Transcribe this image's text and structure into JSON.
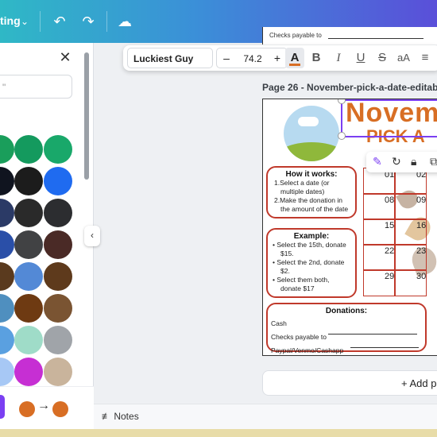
{
  "topbar": {
    "menu_label": "ting",
    "icons": [
      "chevron-down-icon",
      "undo-icon",
      "redo-icon",
      "cloud-saved-icon"
    ]
  },
  "panel": {
    "search_placeholder": "\"",
    "swatches": [
      "#1a9e5b",
      "#149a5e",
      "#19a86a",
      "#10141f",
      "#1c1c1c",
      "#1f6bf0",
      "#2b3a66",
      "#2a2a2a",
      "#2c2d30",
      "#2a4fa8",
      "#414244",
      "#4a2a26",
      "#5a3a1e",
      "#5389d6",
      "#5e3a1c",
      "#4f8fbf",
      "#6e3a12",
      "#7a5432",
      "#5aa0e0",
      "#9fdcc8",
      "#a0a4a9",
      "#a7c8f5",
      "#c62fd3",
      "#c9b49c"
    ],
    "accent_purple": "#7b3ff2",
    "gradient_from": "#d86e24",
    "gradient_to": "#d86e24"
  },
  "toolbar": {
    "font_name": "Luckiest Guy",
    "font_size": "74.2",
    "minus": "–",
    "plus": "+",
    "text_color_letter": "A",
    "text_color": "#d86e24",
    "bold": "B",
    "italic": "I",
    "underline": "U",
    "strike": "S",
    "case": "aA"
  },
  "canvas": {
    "prev_page_text": "Checks payable to",
    "page_title": "Page 26 - November-pick-a-date-editable",
    "title_line1": "Novem",
    "title_line2": "PICK A",
    "how_title": "How it works:",
    "how_items": [
      "1.Select a date (or",
      "multiple dates)",
      "2.Make the donation in",
      "the amount of the date"
    ],
    "example_title": "Example:",
    "example_items": [
      "• Select the 15th, donate",
      "$15.",
      "• Select the 2nd, donate",
      "$2.",
      "• Select them both,",
      "donate $17"
    ],
    "donations_title": "Donations:",
    "donation_lines": [
      "Cash",
      "Checks payable to",
      "Paypal/Venmo/Cashapp"
    ],
    "cal_numbers": [
      "01",
      "02",
      "08",
      "09",
      "15",
      "16",
      "22",
      "23",
      "29",
      "30"
    ],
    "add_page": "+ Add p",
    "notes": "Notes"
  }
}
